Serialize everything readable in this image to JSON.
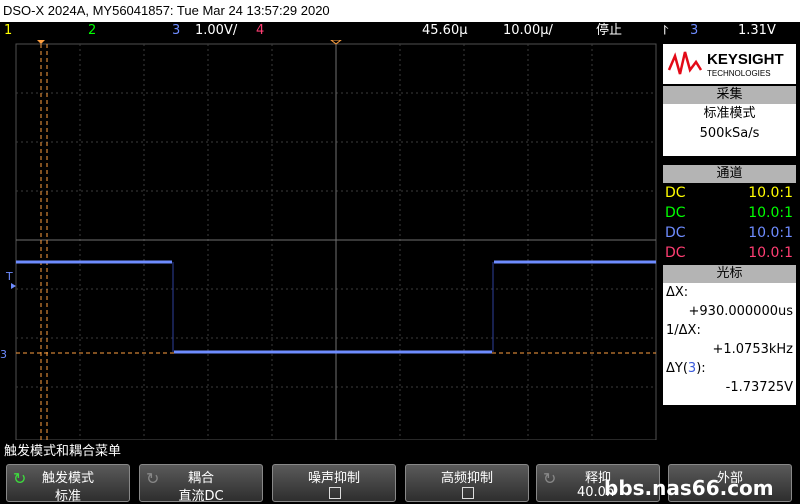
{
  "title": "DSO-X 2024A, MY56041857: Tue Mar 24 13:57:29 2020",
  "status": {
    "ch1": "1",
    "ch2": "2",
    "ch3": "3",
    "ch3_scale": "1.00V/",
    "ch4": "4",
    "time_pos": "45.60µ",
    "time_scale": "10.00µ/",
    "run_state": "停止",
    "trig_symbol": "⨡",
    "trig_src": "3",
    "trig_level": "1.31V"
  },
  "colors": {
    "ch1": "#ffff00",
    "ch2": "#00ff00",
    "ch3": "#6e8cff",
    "ch4": "#ff3e73",
    "cursor": "#ffa040",
    "grid": "#505050"
  },
  "brand": {
    "name": "KEYSIGHT",
    "sub": "TECHNOLOGIES",
    "logo_icon": "keysight-wave-icon"
  },
  "acquire": {
    "header": "采集",
    "mode": "标准模式",
    "rate": "500kSa/s"
  },
  "channels": {
    "header": "通道",
    "rows": [
      {
        "coupling": "DC",
        "probe": "10.0:1"
      },
      {
        "coupling": "DC",
        "probe": "10.0:1"
      },
      {
        "coupling": "DC",
        "probe": "10.0:1"
      },
      {
        "coupling": "DC",
        "probe": "10.0:1"
      }
    ]
  },
  "cursors": {
    "header": "光标",
    "dx_label": "ΔX:",
    "dx_value": "+930.000000us",
    "inv_label": "1/ΔX:",
    "inv_value": "+1.0753kHz",
    "dy_label_prefix": "ΔY(",
    "dy_src": "3",
    "dy_label_suffix": "):",
    "dy_value": "-1.73725V"
  },
  "markers": {
    "trig_t": "T",
    "ch3_mark": "3"
  },
  "message": "触发模式和耦合菜单",
  "softkeys": [
    {
      "title": "触发模式",
      "value": "标准",
      "icon": "rotate-knob-icon"
    },
    {
      "title": "耦合",
      "value": "直流DC",
      "icon": "rotate-knob-icon"
    },
    {
      "title": "噪声抑制",
      "value": ""
    },
    {
      "title": "高频抑制",
      "value": ""
    },
    {
      "title": "释抑",
      "value": "40.0n",
      "icon": "rotate-knob-icon"
    },
    {
      "title": "外部",
      "value": ""
    }
  ],
  "watermark": "bbs.nas66.com"
}
